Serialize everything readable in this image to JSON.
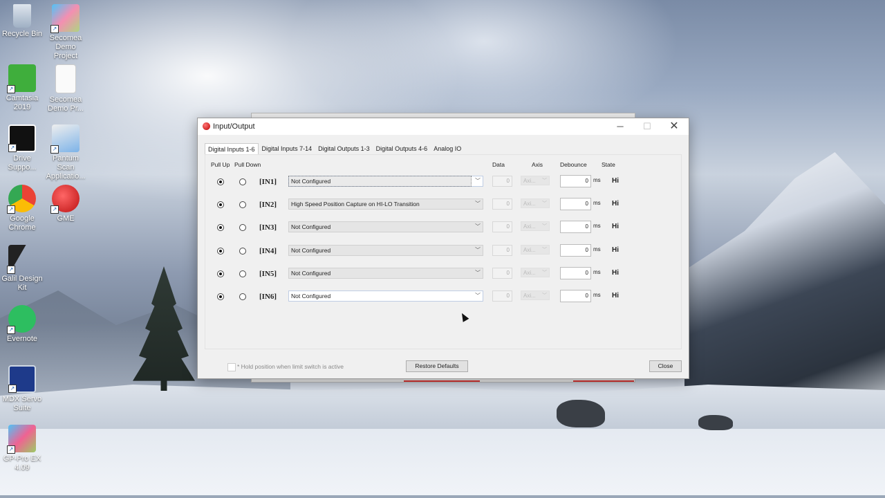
{
  "desktop": {
    "icons": [
      {
        "label": "Recycle Bin",
        "icon": "recycle-bin-icon"
      },
      {
        "label": "Secomea Demo Project",
        "icon": "folder-icon"
      },
      {
        "label": "Camtasia 2019",
        "icon": "camtasia-icon"
      },
      {
        "label": "Secomea Demo Pr...",
        "icon": "document-icon"
      },
      {
        "label": "Drive Suppo...",
        "icon": "drive-support-icon"
      },
      {
        "label": "Pantum Scan Applicatio...",
        "icon": "scanner-icon"
      },
      {
        "label": "Google Chrome",
        "icon": "chrome-icon"
      },
      {
        "label": "GME",
        "icon": "gme-icon"
      },
      {
        "label": "Galil Design Kit",
        "icon": "galil-icon"
      },
      {
        "label": "Evernote",
        "icon": "evernote-icon"
      },
      {
        "label": "MDX Servo Suite",
        "icon": "mdx-servo-icon"
      },
      {
        "label": "GP-Pro EX 4.09",
        "icon": "gp-pro-icon"
      }
    ]
  },
  "dialog": {
    "title": "Input/Output",
    "minimize": "─",
    "maximize": "☐",
    "close": "✕",
    "tabs": [
      {
        "label": "Digital Inputs  1-6",
        "active": true
      },
      {
        "label": "Digital Inputs 7-14",
        "active": false
      },
      {
        "label": "Digital Outputs 1-3",
        "active": false
      },
      {
        "label": "Digital Outputs 4-6",
        "active": false
      },
      {
        "label": "Analog IO",
        "active": false
      }
    ],
    "headers": {
      "pull_up": "Pull Up",
      "pull_down": "Pull Down",
      "data": "Data",
      "axis": "Axis",
      "debounce": "Debounce",
      "state": "State"
    },
    "rows": [
      {
        "label": "[IN1]",
        "function": "Not Configured",
        "data": "0",
        "axis": "Axi...",
        "debounce": "0",
        "unit": "ms",
        "state": "Hi"
      },
      {
        "label": "[IN2]",
        "function": "High Speed Position Capture on HI-LO Transition",
        "data": "0",
        "axis": "Axi...",
        "debounce": "0",
        "unit": "ms",
        "state": "Hi"
      },
      {
        "label": "[IN3]",
        "function": "Not Configured",
        "data": "0",
        "axis": "Axi...",
        "debounce": "0",
        "unit": "ms",
        "state": "Hi"
      },
      {
        "label": "[IN4]",
        "function": "Not Configured",
        "data": "0",
        "axis": "Axi...",
        "debounce": "0",
        "unit": "ms",
        "state": "Hi"
      },
      {
        "label": "[IN5]",
        "function": "Not Configured",
        "data": "0",
        "axis": "Axi...",
        "debounce": "0",
        "unit": "ms",
        "state": "Hi"
      },
      {
        "label": "[IN6]",
        "function": "Not Configured",
        "data": "0",
        "axis": "Axi...",
        "debounce": "0",
        "unit": "ms",
        "state": "Hi"
      }
    ],
    "footer": {
      "hold_text": "* Hold position when limit switch is active",
      "restore": "Restore Defaults",
      "close": "Close"
    }
  },
  "colors": {
    "dialog_bg": "#f0f0f0",
    "titlebar_bg": "#ffffff",
    "accent_red": "#d33333"
  }
}
